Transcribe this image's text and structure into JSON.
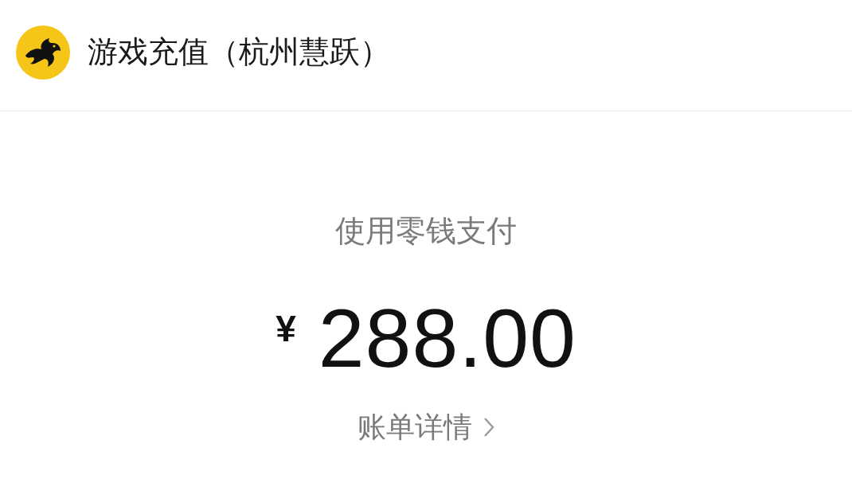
{
  "header": {
    "title": "游戏充值（杭州慧跃）"
  },
  "payment": {
    "method": "使用零钱支付",
    "currency": "¥",
    "amount": "288.00"
  },
  "details_link": {
    "label": "账单详情"
  }
}
